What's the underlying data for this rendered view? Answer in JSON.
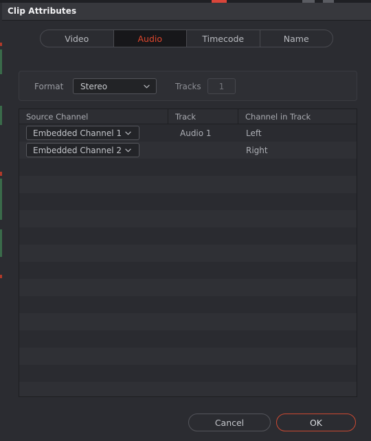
{
  "window": {
    "title": "Clip Attributes"
  },
  "tabs": [
    {
      "label": "Video",
      "active": false
    },
    {
      "label": "Audio",
      "active": true
    },
    {
      "label": "Timecode",
      "active": false
    },
    {
      "label": "Name",
      "active": false
    }
  ],
  "format": {
    "label": "Format",
    "value": "Stereo",
    "tracks_label": "Tracks",
    "tracks_value": "1"
  },
  "table": {
    "columns": [
      "Source Channel",
      "Track",
      "Channel in Track"
    ],
    "rows": [
      {
        "source_channel": "Embedded Channel 1",
        "track": "Audio 1",
        "channel_in_track": "Left"
      },
      {
        "source_channel": "Embedded Channel 2",
        "track": "",
        "channel_in_track": "Right"
      }
    ],
    "empty_row_count": 14
  },
  "footer": {
    "cancel_label": "Cancel",
    "ok_label": "OK"
  },
  "colors": {
    "accent_red": "#e0472d",
    "ok_border": "#cf4a32",
    "dialog_bg": "#2b2c31",
    "titlebar_bg": "#37383d",
    "active_tab_bg": "#17171a"
  }
}
